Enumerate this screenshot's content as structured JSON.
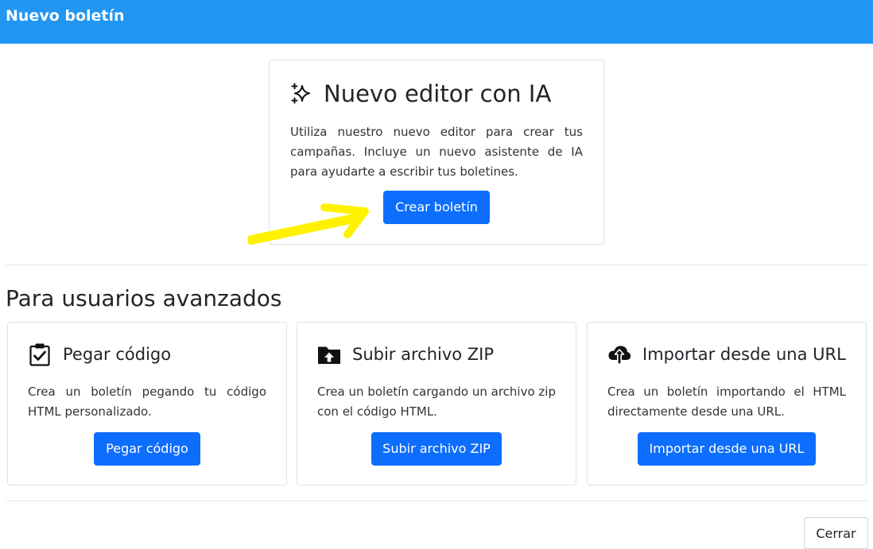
{
  "header": {
    "title": "Nuevo boletín",
    "color": "#2196f3"
  },
  "ai_editor": {
    "icon": "sparkles-icon",
    "title": "Nuevo editor con IA",
    "description": "Utiliza nuestro nuevo editor para crear tus campañas. Incluye un nuevo asistente de IA para ayudarte a escribir tus boletines.",
    "button_label": "Crear boletín"
  },
  "annotation": {
    "icon": "yellow-arrow-icon",
    "color": "#fff200"
  },
  "advanced": {
    "title": "Para usuarios avanzados",
    "cards": [
      {
        "icon": "clipboard-check-icon",
        "title": "Pegar código",
        "description": "Crea un boletín pegando tu código HTML personalizado.",
        "button_label": "Pegar código"
      },
      {
        "icon": "folder-upload-icon",
        "title": "Subir archivo ZIP",
        "description": "Crea un boletín cargando un archivo zip con el código HTML.",
        "button_label": "Subir archivo ZIP"
      },
      {
        "icon": "cloud-upload-icon",
        "title": "Importar desde una URL",
        "description": "Crea un boletín importando el HTML directamente desde una URL.",
        "button_label": "Importar desde una URL"
      }
    ]
  },
  "footer": {
    "close_label": "Cerrar"
  },
  "colors": {
    "primary_button": "#0d6efd",
    "border": "#dee2e6"
  }
}
